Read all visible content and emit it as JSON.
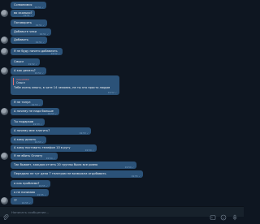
{
  "messages": [
    {
      "text": "Созвонимся",
      "time": "19:51"
    },
    {
      "text": "во сколько?",
      "time": "19:51"
    },
    {
      "text": "Поговорить",
      "time": "19:51"
    },
    {
      "text": "Добавьте чеки",
      "time": "19:51"
    },
    {
      "text": "Добавить",
      "time": "19:51"
    },
    {
      "text": "Я не буду ничего добавлять",
      "time": "19:52"
    },
    {
      "text": "Смысл",
      "time": "19:52"
    },
    {
      "text": "А как делать?",
      "time": "19:52"
    },
    {
      "text": "Я не тянул",
      "time": "19:53"
    },
    {
      "text": "А почему не надо больше",
      "time": "19:53"
    },
    {
      "text": "Ты подарков",
      "time": "19:53"
    },
    {
      "text": "А почему мне платить?",
      "time": "19:53"
    },
    {
      "text": "А кому делать",
      "time": "19:53"
    },
    {
      "text": "А кому поставить телефон 10 в ругу",
      "time": "19:54"
    },
    {
      "text": "Я не вбить Оплату",
      "time": "19:54"
    },
    {
      "text": "Так бывает, каждая отчеть 20 группы была все ровно",
      "time": "19:54"
    },
    {
      "text": "Передали не тут дела 7 телеграм не возможна отдобавить",
      "time": "19:55"
    },
    {
      "text": "а как проблема?",
      "time": "19:55"
    },
    {
      "text": "я не понимаю",
      "time": "19:55"
    },
    {
      "text": "??",
      "time": "19:55"
    }
  ],
  "reply_message": {
    "quote_author": "Valve6969",
    "quote_text": "Смысл",
    "text": "Тебе очень много, в чате 14 человек, не ты это просто людям",
    "time": "19:52"
  },
  "composer": {
    "placeholder": "Написать сообщение..."
  },
  "colors": {
    "background": "#0e1621",
    "bubble": "#2b5278",
    "composer": "#17212b",
    "quote_accent": "#e57373"
  },
  "icons": {
    "attach": "paperclip-icon",
    "commands": "bot-commands-icon",
    "emoji": "emoji-icon",
    "voice": "microphone-icon"
  }
}
